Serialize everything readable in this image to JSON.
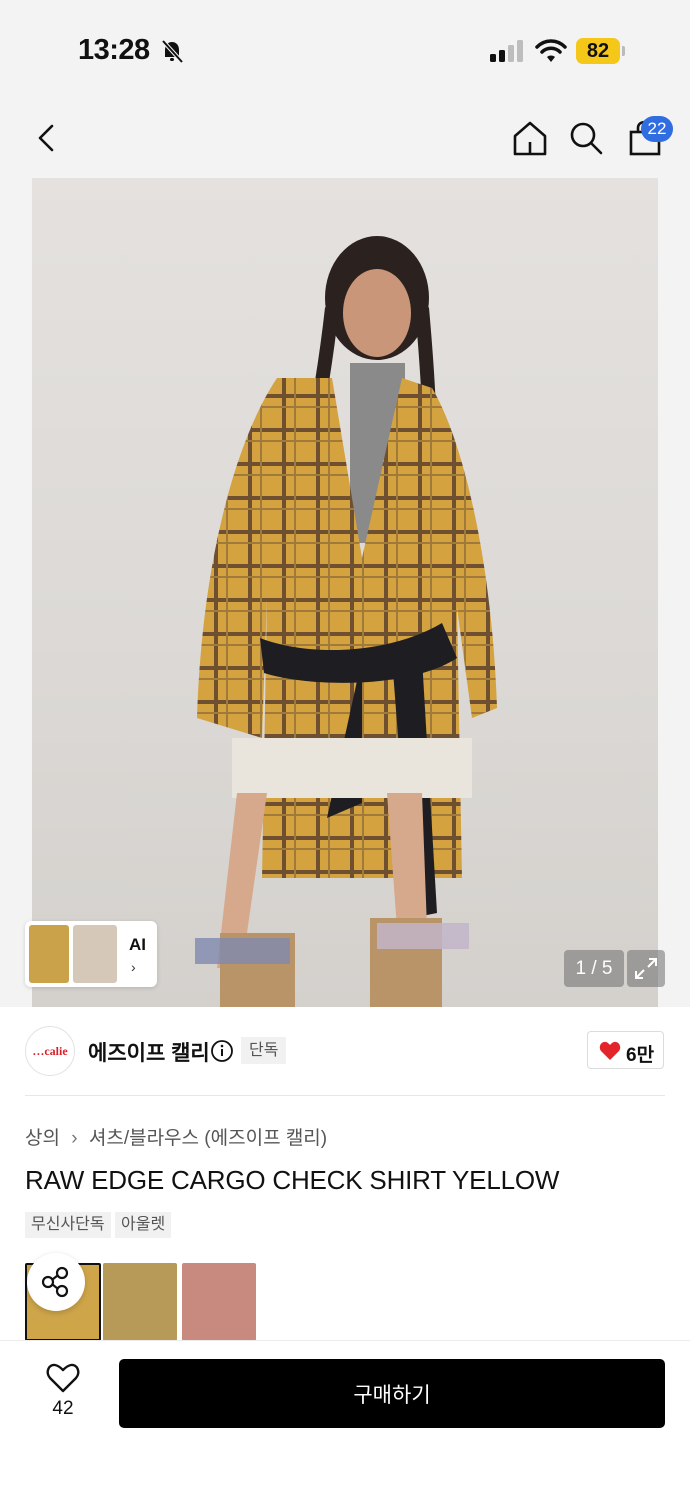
{
  "status_bar": {
    "time": "13:28",
    "battery": "82",
    "icons": [
      "bell-slash-icon",
      "signal-icon",
      "wifi-icon",
      "battery-icon"
    ]
  },
  "header": {
    "icons": [
      "back-icon",
      "home-icon",
      "search-icon",
      "cart-icon"
    ],
    "cart_badge": "22",
    "badge_color": "#2f6de1"
  },
  "gallery": {
    "counter": "1 / 5",
    "ai_label": "AI",
    "ai_chevron": "›",
    "expand_icon": "expand-icon"
  },
  "brand": {
    "logo_text": "…calie",
    "name": "에즈이프 캘리",
    "exclusive": "단독",
    "likes": "6만",
    "like_color": "#e3242b"
  },
  "product": {
    "breadcrumb": [
      "상의",
      "셔츠/블라우스 (에즈이프 캘리)"
    ],
    "breadcrumb_sep": "›",
    "title": "RAW EDGE CARGO CHECK SHIRT YELLOW",
    "tags": [
      "무신사단독",
      "아울렛"
    ]
  },
  "bottom_bar": {
    "wish_count": "42",
    "buy_label": "구매하기"
  }
}
